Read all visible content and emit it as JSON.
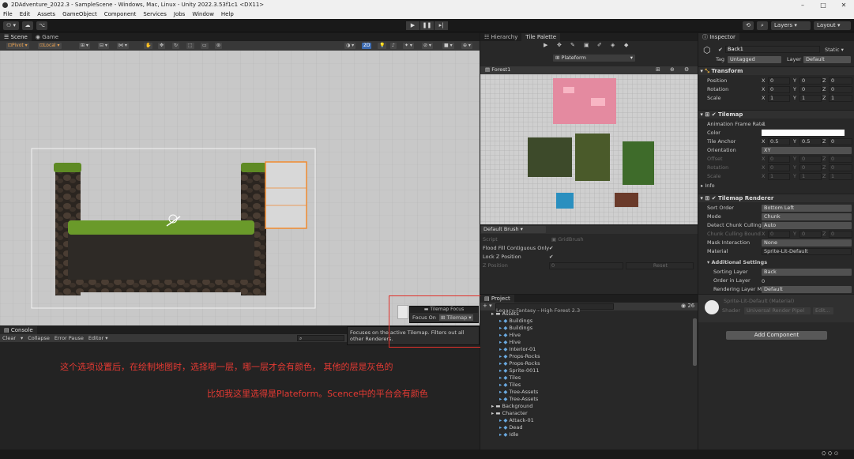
{
  "window": {
    "title": "2DAdventure_2022.3 - SampleScene - Windows, Mac, Linux - Unity 2022.3.53f1c1 <DX11>",
    "minimize": "–",
    "maximize": "□",
    "close": "✕"
  },
  "menu": [
    "File",
    "Edit",
    "Assets",
    "GameObject",
    "Component",
    "Services",
    "Jobs",
    "Window",
    "Help"
  ],
  "toolbar": {
    "layers": "Layers",
    "layout": "Layout"
  },
  "scene": {
    "tabs": [
      "Scene",
      "Game"
    ],
    "pivot": "Pivot",
    "local": "Local",
    "mode2d": "2D"
  },
  "tile_focus": {
    "title": "Tilemap Focus",
    "label": "Focus On",
    "value": "Tilemap"
  },
  "tooltip": "Focuses on the active Tilemap. Filters out all other Renderers.",
  "console": {
    "tab": "Console",
    "clear": "Clear",
    "collapse": "Collapse",
    "error_pause": "Error Pause",
    "editor": "Editor"
  },
  "annotations": {
    "line1": "这个选项设置后，在绘制地图时，选择哪一层，哪一层才会有颜色， 其他的层是灰色的",
    "line2": "比如我这里选得是Plateform。Scence中的平台会有颜色"
  },
  "tile_palette": {
    "tabs": [
      "Hierarchy",
      "Tile Palette"
    ],
    "target": "Plateform",
    "palette": "Forest1",
    "brush": "Default Brush",
    "script_label": "Script",
    "script_value": "GridBrush",
    "flood_label": "Flood Fill Contiguous Only",
    "lockz_label": "Lock Z Position",
    "zpos_label": "Z Position",
    "zpos_value": "0",
    "reset": "Reset"
  },
  "project": {
    "tab": "Project",
    "count": "26",
    "breadcrumb": "Legacy-Fantasy - High Forest 2.3",
    "items": [
      {
        "label": "Assets",
        "indent": 1
      },
      {
        "label": "Buildings",
        "indent": 2
      },
      {
        "label": "Buildings",
        "indent": 2
      },
      {
        "label": "Hive",
        "indent": 2
      },
      {
        "label": "Hive",
        "indent": 2
      },
      {
        "label": "Interior-01",
        "indent": 2
      },
      {
        "label": "Props-Rocks",
        "indent": 2
      },
      {
        "label": "Props-Rocks",
        "indent": 2
      },
      {
        "label": "Sprite-0011",
        "indent": 2
      },
      {
        "label": "Tiles",
        "indent": 2
      },
      {
        "label": "Tiles",
        "indent": 2
      },
      {
        "label": "Tree-Assets",
        "indent": 2
      },
      {
        "label": "Tree-Assets",
        "indent": 2
      },
      {
        "label": "Background",
        "indent": 1
      },
      {
        "label": "Character",
        "indent": 1
      },
      {
        "label": "Attack-01",
        "indent": 2
      },
      {
        "label": "Dead",
        "indent": 2
      },
      {
        "label": "Idle",
        "indent": 2
      }
    ]
  },
  "inspector": {
    "tab": "Inspector",
    "object_name": "Back1",
    "static": "Static",
    "tag_label": "Tag",
    "tag_value": "Untagged",
    "layer_label": "Layer",
    "layer_value": "Default",
    "transform": {
      "title": "Transform",
      "rows": [
        {
          "label": "Position",
          "x": "0",
          "y": "0",
          "z": "0"
        },
        {
          "label": "Rotation",
          "x": "0",
          "y": "0",
          "z": "0"
        },
        {
          "label": "Scale",
          "x": "1",
          "y": "1",
          "z": "1"
        }
      ]
    },
    "tilemap": {
      "title": "Tilemap",
      "anim_label": "Animation Frame Rate",
      "anim_value": "1",
      "color_label": "Color",
      "anchor_label": "Tile Anchor",
      "anchor": {
        "x": "0.5",
        "y": "0.5",
        "z": "0"
      },
      "orient_label": "Orientation",
      "orient_value": "XY",
      "offset_label": "Offset",
      "rotation_label": "Rotation",
      "scale_label": "Scale",
      "offset": {
        "x": "0",
        "y": "0",
        "z": "0"
      },
      "rot": {
        "x": "0",
        "y": "0",
        "z": "0"
      },
      "scl": {
        "x": "1",
        "y": "1",
        "z": "1"
      },
      "info": "Info"
    },
    "renderer": {
      "title": "Tilemap Renderer",
      "sort_order_label": "Sort Order",
      "sort_order_value": "Bottom Left",
      "mode_label": "Mode",
      "mode_value": "Chunk",
      "culling_label": "Detect Chunk Culling",
      "culling_value": "Auto",
      "bounds_label": "Chunk Culling Bound",
      "bounds": {
        "x": "0",
        "y": "0",
        "z": "0"
      },
      "mask_label": "Mask Interaction",
      "mask_value": "None",
      "material_label": "Material",
      "material_value": "Sprite-Lit-Default",
      "additional": "Additional Settings",
      "sorting_layer_label": "Sorting Layer",
      "sorting_layer_value": "Back",
      "order_label": "Order in Layer",
      "order_value": "0",
      "rendering_label": "Rendering Layer M",
      "rendering_value": "Default"
    },
    "material_card": {
      "name": "Sprite-Lit-Default (Material)",
      "shader_label": "Shader",
      "shader_value": "Universal Render Pipel",
      "edit": "Edit..."
    },
    "add_component": "Add Component"
  }
}
